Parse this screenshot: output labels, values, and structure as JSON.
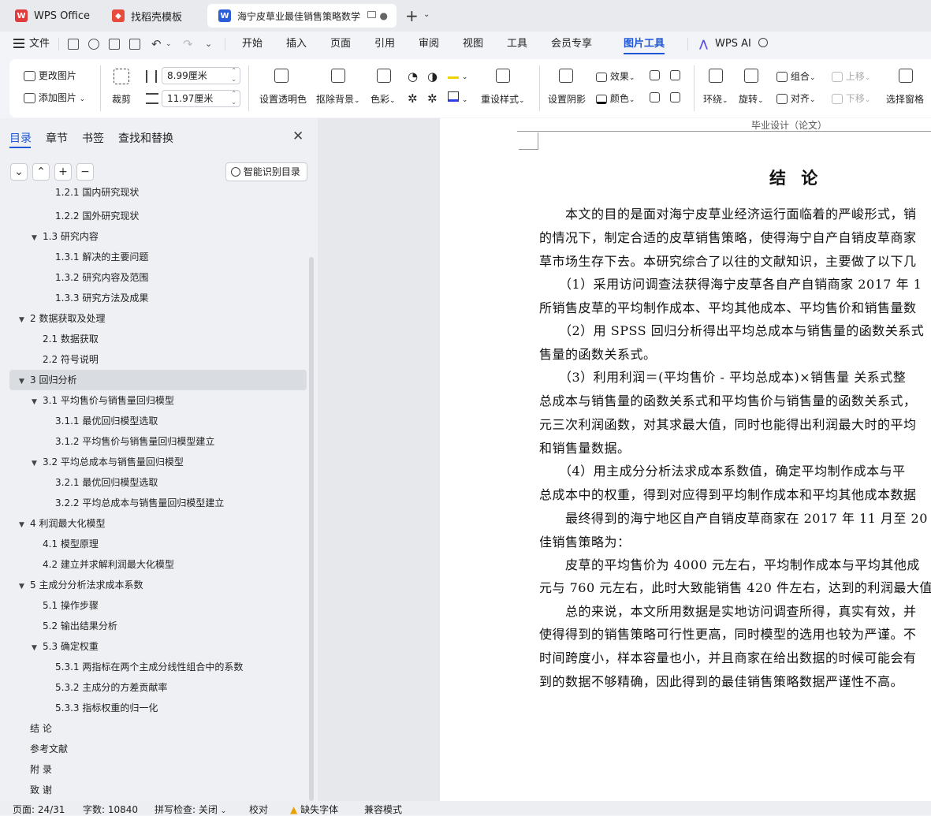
{
  "tabs": [
    {
      "label": "WPS Office"
    },
    {
      "label": "找稻壳模板"
    },
    {
      "label": "海宁皮草业最佳销售策略数学"
    }
  ],
  "menu": {
    "file": "文件",
    "items": [
      "开始",
      "插入",
      "页面",
      "引用",
      "审阅",
      "视图",
      "工具",
      "会员专享",
      "图片工具"
    ],
    "wps_ai": "WPS AI"
  },
  "ribbon": {
    "change_image": "更改图片",
    "add_image": "添加图片",
    "crop": "裁剪",
    "width_value": "8.99厘米",
    "height_value": "11.97厘米",
    "set_transparent": "设置透明色",
    "remove_bg": "抠除背景",
    "color": "色彩",
    "reset_style": "重设样式",
    "set_shadow": "设置阴影",
    "effect": "效果",
    "color2": "颜色",
    "wrap": "环绕",
    "rotate": "旋转",
    "group": "组合",
    "align": "对齐",
    "move_up": "上移",
    "move_down": "下移",
    "selection_pane": "选择窗格"
  },
  "nav": {
    "tabs": [
      "目录",
      "章节",
      "书签",
      "查找和替换"
    ],
    "smart_toc": "智能识别目录",
    "items": [
      {
        "label": "1.2.1 国内研究现状"
      },
      {
        "label": "1.2.2 国外研究现状"
      },
      {
        "label": "1.3 研究内容"
      },
      {
        "label": "1.3.1 解决的主要问题"
      },
      {
        "label": "1.3.2 研究内容及范围"
      },
      {
        "label": "1.3.3 研究方法及成果"
      },
      {
        "label": "2 数据获取及处理"
      },
      {
        "label": "2.1 数据获取"
      },
      {
        "label": "2.2 符号说明"
      },
      {
        "label": "3 回归分析"
      },
      {
        "label": "3.1 平均售价与销售量回归模型"
      },
      {
        "label": "3.1.1 最优回归模型选取"
      },
      {
        "label": "3.1.2 平均售价与销售量回归模型建立"
      },
      {
        "label": "3.2 平均总成本与销售量回归模型"
      },
      {
        "label": "3.2.1 最优回归模型选取"
      },
      {
        "label": "3.2.2 平均总成本与销售量回归模型建立"
      },
      {
        "label": "4 利润最大化模型"
      },
      {
        "label": "4.1 模型原理"
      },
      {
        "label": "4.2 建立并求解利润最大化模型"
      },
      {
        "label": "5 主成分分析法求成本系数"
      },
      {
        "label": "5.1 操作步骤"
      },
      {
        "label": "5.2 输出结果分析"
      },
      {
        "label": "5.3 确定权重"
      },
      {
        "label": "5.3.1 两指标在两个主成分线性组合中的系数"
      },
      {
        "label": "5.3.2 主成分的方差贡献率"
      },
      {
        "label": "5.3.3 指标权重的归一化"
      },
      {
        "label": "结 论"
      },
      {
        "label": "参考文献"
      },
      {
        "label": "附 录"
      },
      {
        "label": "致 谢"
      }
    ]
  },
  "doc": {
    "header": "毕业设计（论文）",
    "title": "结 论",
    "lines": [
      "　　本文的目的是面对海宁皮草业经济运行面临着的严峻形式，销",
      "的情况下，制定合适的皮草销售策略，使得海宁自产自销皮草商家",
      "草市场生存下去。本研究综合了以往的文献知识，主要做了以下几",
      "　　（1）采用访问调查法获得海宁皮草各自产自销商家 2017 年 1",
      "所销售皮草的平均制作成本、平均其他成本、平均售价和销售量数",
      "　　（2）用 SPSS 回归分析得出平均总成本与销售量的函数关系式",
      "售量的函数关系式。",
      "　　（3）利用利润＝(平均售价 - 平均总成本)×销售量 关系式整",
      "总成本与销售量的函数关系式和平均售价与销售量的函数关系式，",
      "元三次利润函数，对其求最大值，同时也能得出利润最大时的平均",
      "和销售量数据。",
      "　　（4）用主成分分析法求成本系数值，确定平均制作成本与平",
      "总成本中的权重，得到对应得到平均制作成本和平均其他成本数据",
      "　　最终得到的海宁地区自产自销皮草商家在 2017 年 11 月至 20",
      "佳销售策略为：",
      "　　皮草的平均售价为 4000 元左右，平均制作成本与平均其他成",
      "元与 760 元左右，此时大致能销售 420 件左右，达到的利润最大值",
      "　　总的来说，本文所用数据是实地访问调查所得，真实有效，并",
      "使得得到的销售策略可行性更高，同时模型的选用也较为严谨。不",
      "时间跨度小，样本容量也小，并且商家在给出数据的时候可能会有",
      "到的数据不够精确，因此得到的最佳销售策略数据严谨性不高。"
    ]
  },
  "status": {
    "page": "页面: 24/31",
    "words": "字数: 10840",
    "spell": "拼写检查: 关闭",
    "proof": "校对",
    "missing_font": "缺失字体",
    "compat": "兼容模式"
  }
}
